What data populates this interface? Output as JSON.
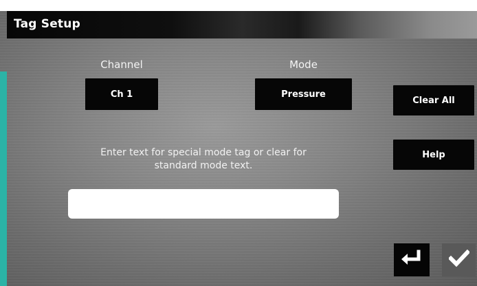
{
  "header": {
    "title": "Tag Setup"
  },
  "channel": {
    "label": "Channel",
    "value": "Ch 1"
  },
  "mode": {
    "label": "Mode",
    "value": "Pressure"
  },
  "buttons": {
    "clear_all": "Clear All",
    "help": "Help"
  },
  "instructions": {
    "line1": "Enter text for special mode tag or clear for",
    "line2": "standard mode text."
  },
  "tag_input": {
    "value": "",
    "placeholder": ""
  },
  "icons": {
    "back": "return-arrow-icon",
    "confirm": "checkmark-icon"
  },
  "colors": {
    "accent": "#2bb3a6",
    "button_bg": "#060606",
    "text": "#ffffff"
  }
}
